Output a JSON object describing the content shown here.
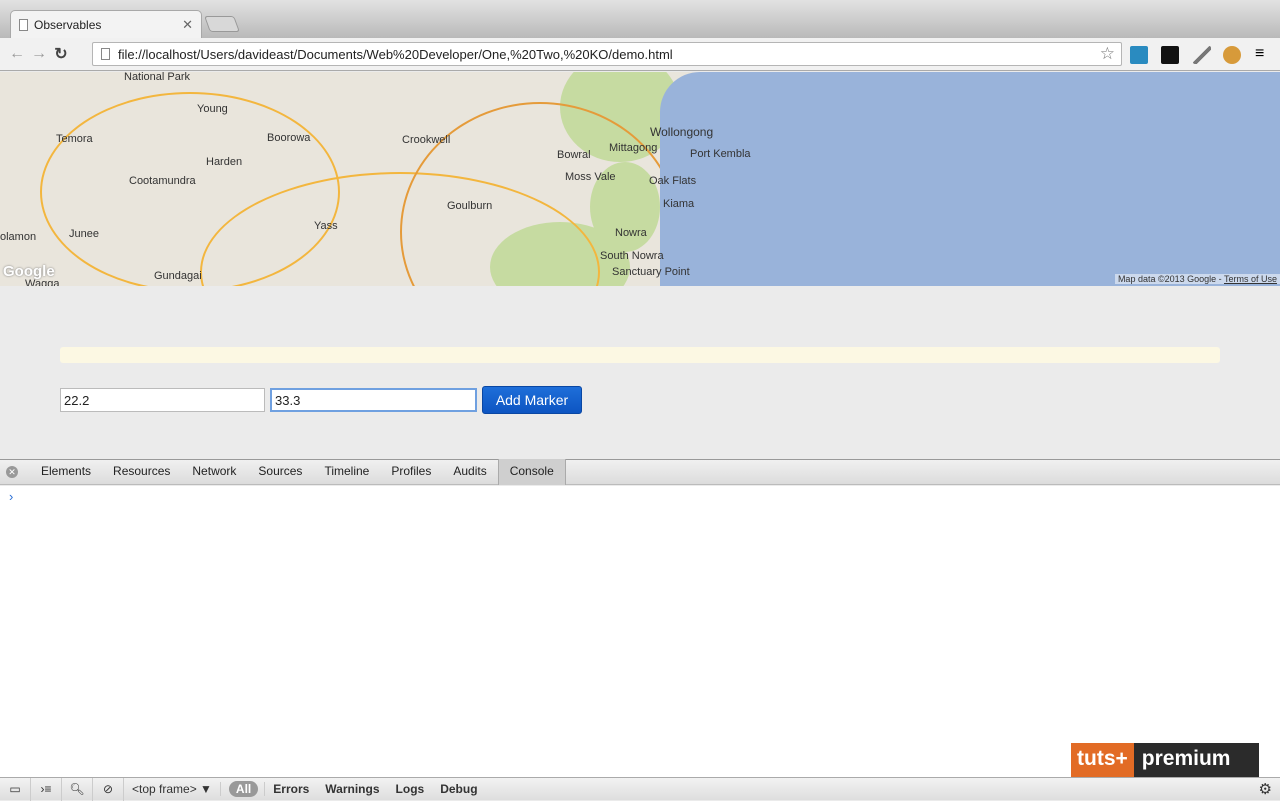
{
  "browser": {
    "tab_title": "Observables",
    "url": "file://localhost/Users/davideast/Documents/Web%20Developer/One,%20Two,%20KO/demo.html"
  },
  "map": {
    "labels": [
      "National Park",
      "Young",
      "Boorowa",
      "Crookwell",
      "Temora",
      "Harden",
      "Cootamundra",
      "Goulburn",
      "Yass",
      "Junee",
      "olamon",
      "Gundagai",
      "Wollongong",
      "Port Kembla",
      "Bowral",
      "Mittagong",
      "Moss Vale",
      "Oak Flats",
      "Kiama",
      "Nowra",
      "South Nowra",
      "Sanctuary Point",
      "Wagga"
    ],
    "attribution": "Map data ©2013 Google - ",
    "terms": "Terms of Use",
    "logo": "Google"
  },
  "form": {
    "lat": "22.2",
    "lng": "33.3",
    "add_label": "Add Marker"
  },
  "devtools": {
    "tabs": [
      "Elements",
      "Resources",
      "Network",
      "Sources",
      "Timeline",
      "Profiles",
      "Audits",
      "Console"
    ],
    "prompt": "›",
    "frame": "<top frame> ▼",
    "filters": [
      "All",
      "Errors",
      "Warnings",
      "Logs",
      "Debug"
    ]
  },
  "brand": {
    "left": "tuts+",
    "right": "premium"
  }
}
